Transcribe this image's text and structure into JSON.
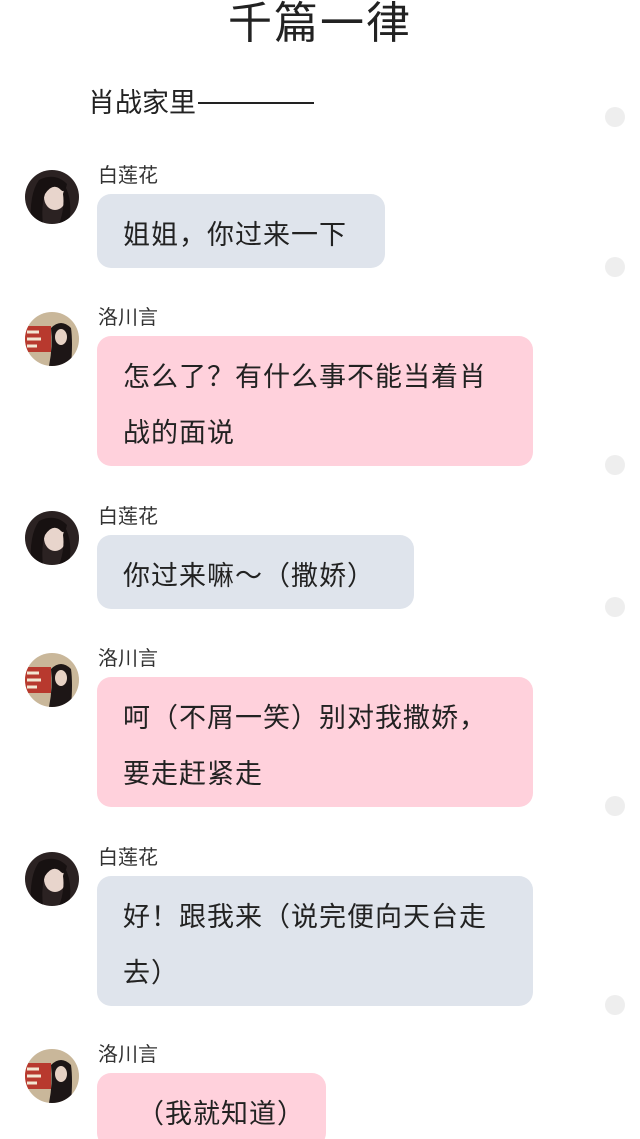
{
  "story": {
    "title": "千篇一律",
    "scene": "肖战家里"
  },
  "messages": [
    {
      "sender": "白莲花",
      "text": "姐姐，你过来一下",
      "style": "gray",
      "avatar": "white-lotus-avatar"
    },
    {
      "sender": "洛川言",
      "text": "怎么了？有什么事不能当着肖战的面说",
      "style": "pink",
      "avatar": "luo-chuanyan-avatar"
    },
    {
      "sender": "白莲花",
      "text": "你过来嘛～（撒娇）",
      "style": "gray",
      "avatar": "white-lotus-avatar"
    },
    {
      "sender": "洛川言",
      "text": "呵（不屑一笑）别对我撒娇，要走赶紧走",
      "style": "pink",
      "avatar": "luo-chuanyan-avatar"
    },
    {
      "sender": "白莲花",
      "text": "好！跟我来（说完便向天台走去）",
      "style": "gray",
      "avatar": "white-lotus-avatar"
    },
    {
      "sender": "洛川言",
      "text": "（我就知道）",
      "style": "pink",
      "avatar": "luo-chuanyan-avatar"
    }
  ],
  "colors": {
    "gray_bubble": "#dfe4ec",
    "pink_bubble": "#ffd1dc",
    "side_dot": "#eeeeee"
  }
}
